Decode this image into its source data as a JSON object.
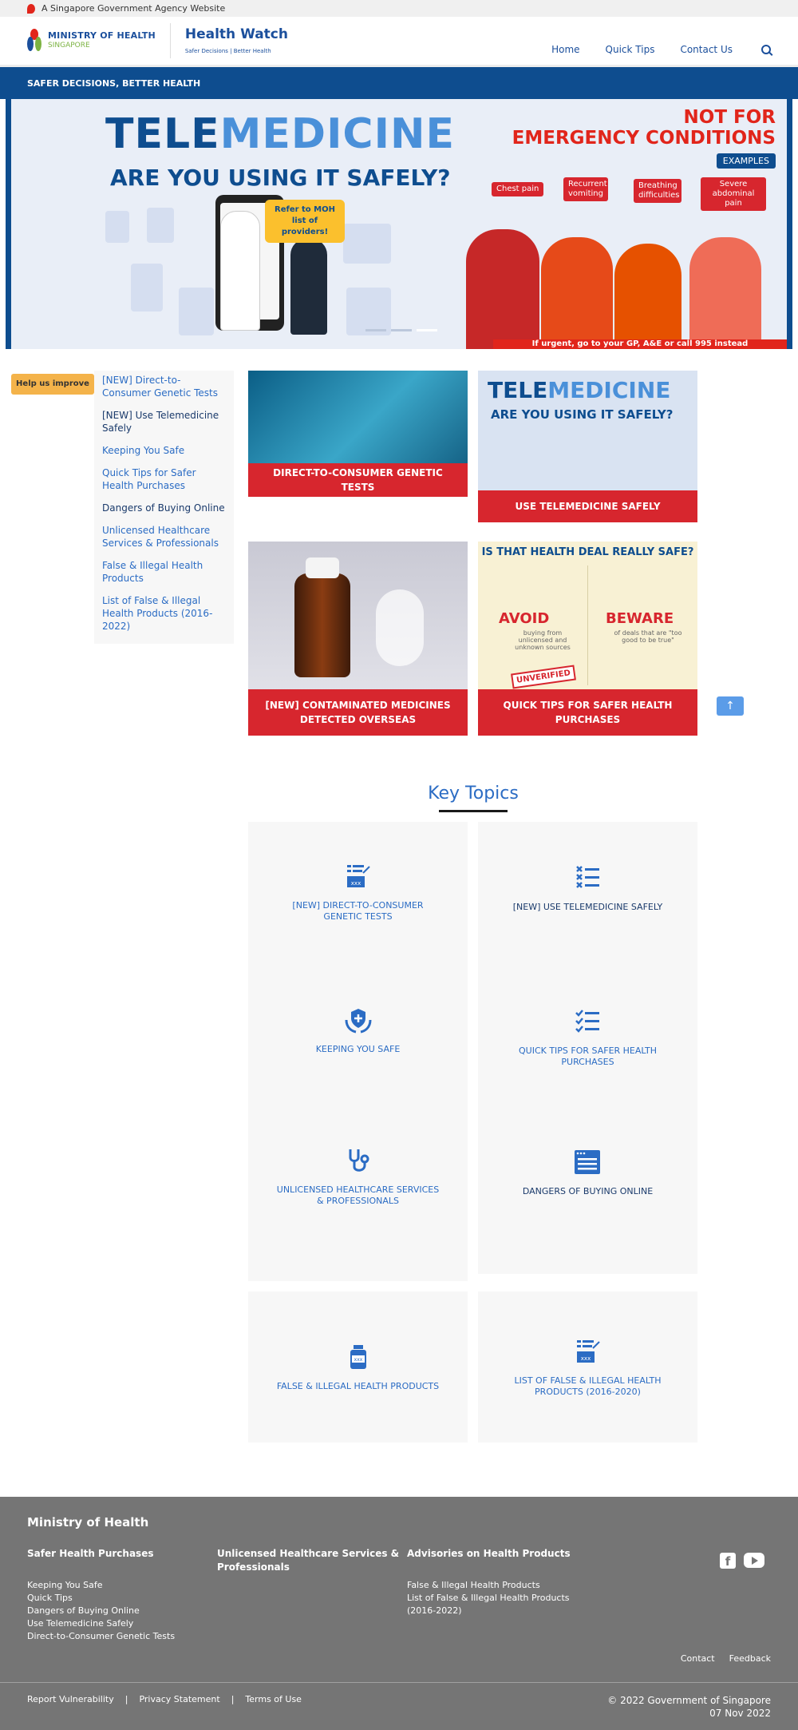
{
  "gov_bar": {
    "text": "A Singapore Government Agency Website"
  },
  "header": {
    "moh_name": "MINISTRY OF HEALTH",
    "moh_country": "SINGAPORE",
    "hw_title": "Health Watch",
    "hw_subtitle": "Safer Decisions | Better Health",
    "nav": [
      "Home",
      "Quick Tips",
      "Contact Us"
    ]
  },
  "tagline": "SAFER DECISIONS, BETTER HEALTH",
  "hero": {
    "title_a": "TELE",
    "title_b": "MEDICINE",
    "question": "ARE YOU USING IT SAFELY?",
    "warn_line1": "NOT FOR",
    "warn_line2": "EMERGENCY CONDITIONS",
    "examples": "EXAMPLES",
    "chips": [
      "Chest pain",
      "Recurrent vomiting",
      "Breathing difficulties",
      "Severe abdominal pain"
    ],
    "bubble": "Refer to MOH list of providers!",
    "urgent": "If urgent, go to your GP, A&E or call 995 instead"
  },
  "help_button": "Help us improve",
  "sidenav": [
    {
      "label": "[NEW] Direct-to-Consumer Genetic Tests",
      "dark": false
    },
    {
      "label": "[NEW] Use Telemedicine Safely",
      "dark": true
    },
    {
      "label": "Keeping You Safe",
      "dark": false
    },
    {
      "label": "Quick Tips for Safer Health Purchases",
      "dark": false
    },
    {
      "label": "Dangers of Buying Online",
      "dark": true
    },
    {
      "label": "Unlicensed Healthcare Services & Professionals",
      "dark": false
    },
    {
      "label": "False & Illegal Health Products",
      "dark": false
    },
    {
      "label": "List of False & Illegal Health Products (2016-2022)",
      "dark": false
    }
  ],
  "cards": {
    "c1": "DIRECT-TO-CONSUMER GENETIC TESTS",
    "c2": "USE TELEMEDICINE SAFELY",
    "c2_title_a": "TELE",
    "c2_title_b": "MEDICINE",
    "c2_question": "ARE YOU USING IT SAFELY?",
    "c3": "[NEW] CONTAMINATED MEDICINES DETECTED OVERSEAS",
    "c4": "QUICK TIPS FOR SAFER HEALTH PURCHASES",
    "c4_question": "IS THAT HEALTH DEAL REALLY SAFE?",
    "c4_avoid": "AVOID",
    "c4_avoid_sub": "buying from unlicensed and unknown sources",
    "c4_beware": "BEWARE",
    "c4_beware_sub": "of deals that are \"too good to be true\"",
    "c4_stamp": "UNVERIFIED"
  },
  "key_topics": {
    "title": "Key Topics",
    "items": [
      {
        "label": "[NEW] DIRECT-TO-CONSUMER GENETIC TESTS",
        "icon": "checklist-xxx-icon",
        "dark": false
      },
      {
        "label": "[NEW] USE TELEMEDICINE SAFELY",
        "icon": "x-list-icon",
        "dark": true
      },
      {
        "label": "KEEPING YOU SAFE",
        "icon": "hands-shield-icon",
        "dark": false
      },
      {
        "label": "QUICK TIPS FOR SAFER HEALTH PURCHASES",
        "icon": "checklist-icon",
        "dark": false
      },
      {
        "label": "UNLICENSED HEALTHCARE SERVICES & PROFESSIONALS",
        "icon": "stethoscope-icon",
        "dark": false
      },
      {
        "label": "DANGERS OF BUYING ONLINE",
        "icon": "browser-window-icon",
        "dark": true
      },
      {
        "label": "FALSE & ILLEGAL HEALTH PRODUCTS",
        "icon": "medicine-bottle-icon",
        "dark": false
      },
      {
        "label": "LIST OF FALSE & ILLEGAL HEALTH PRODUCTS (2016-2020)",
        "icon": "checklist-xxx-icon",
        "dark": false
      }
    ]
  },
  "footer": {
    "org": "Ministry of Health",
    "col1_title": "Safer Health Purchases",
    "col1_links": [
      "Keeping You Safe",
      "Quick Tips",
      "Dangers of Buying Online",
      "Use Telemedicine Safely",
      "Direct-to-Consumer Genetic Tests"
    ],
    "col2_title": "Unlicensed Healthcare Services & Professionals",
    "col3_title": "Advisories on Health Products",
    "col3_links": [
      "False & Illegal Health Products",
      "List of False & Illegal Health Products (2016-2022)"
    ],
    "right_links": [
      "Contact",
      "Feedback"
    ],
    "bottom_links": [
      "Report Vulnerability",
      "Privacy Statement",
      "Terms of Use"
    ],
    "copyright": "© 2022 Government of Singapore",
    "date": "07 Nov 2022"
  },
  "colors": {
    "brand_blue": "#0e4d8f",
    "link_blue": "#2b6cc4",
    "accent_red": "#d7262e",
    "help_orange": "#f4b34a",
    "footer_grey": "#757575"
  }
}
